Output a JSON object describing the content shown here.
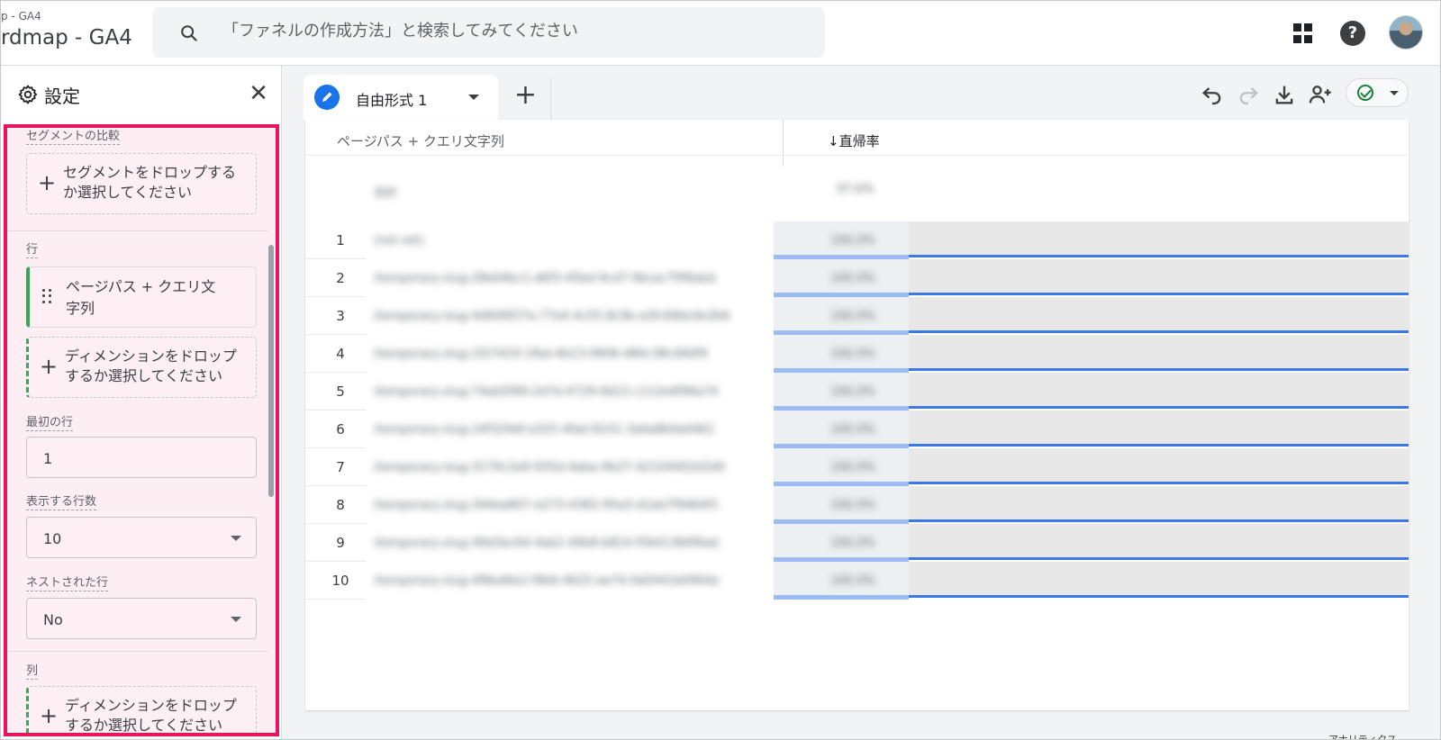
{
  "header": {
    "breadcrumb": "p - GA4",
    "property_title": "rdmap - GA4",
    "search_placeholder": "「ファネルの作成方法」と検索してみてください",
    "icons": [
      "search-icon",
      "apps-icon",
      "help-icon",
      "avatar"
    ]
  },
  "settings": {
    "title": "設定",
    "segment_section": {
      "label": "セグメントの比較",
      "drop_text": "セグメントをドロップするか選択してください"
    },
    "rows_section": {
      "label": "行",
      "dimension_chip": "ページパス + クエリ文字列",
      "drop_text": "ディメンションをドロップするか選択してください"
    },
    "first_row": {
      "label": "最初の行",
      "value": "1"
    },
    "rows_to_show": {
      "label": "表示する行数",
      "value": "10"
    },
    "nested_rows": {
      "label": "ネストされた行",
      "value": "No"
    },
    "columns_section": {
      "label": "列",
      "drop_text": "ディメンションをドロップするか選択してください"
    }
  },
  "tab": {
    "label": "自由形式 1",
    "add_symbol": "+"
  },
  "table": {
    "dimension_header": "ページパス + クエリ文字列",
    "metric_header": "↓直帰率",
    "total_label": "合計",
    "total_value": "97.6%",
    "rows": [
      {
        "num": "1",
        "key": "(not set)",
        "value": "100.0%"
      },
      {
        "num": "2",
        "key": "/temporary-slug-28e04bc1-d6f3-45bd-9cd7-9bcac7f99abd",
        "value": "100.0%"
      },
      {
        "num": "3",
        "key": "/temporary-slug-4d649f27a-77e4-4c55-8c9b-a3fc68dc6e3b6",
        "value": "100.0%"
      },
      {
        "num": "4",
        "key": "/temporary-slug-1f27419-1fbd-4b13-9906-480c38c060f9",
        "value": "100.0%"
      },
      {
        "num": "5",
        "key": "/temporary-slug-74ab5f99-2d7d-4729-9d12-c112e4f96a74",
        "value": "100.0%"
      },
      {
        "num": "6",
        "key": "/temporary-slug-24f329df-a325-4fad-8101-3a6a8b0a0461",
        "value": "100.0%"
      },
      {
        "num": "7",
        "key": "/temporary-slug-3179c2a9-935d-4aba-9b27-42104402d2d0",
        "value": "100.0%"
      },
      {
        "num": "8",
        "key": "/temporary-slug-344ea807-e273-4382-95a3-d1ab7f9464f1",
        "value": "100.0%"
      },
      {
        "num": "9",
        "key": "/temporary-slug-49d3ac64-4ab2-49b8-b814-f5641384f6ad",
        "value": "100.0%"
      },
      {
        "num": "10",
        "key": "/temporary-slug-4f8ed6e2-f9b6-4625-ae74-0d2041b0904e",
        "value": "100.0%"
      }
    ]
  },
  "footer_hint": "アナリティクス"
}
